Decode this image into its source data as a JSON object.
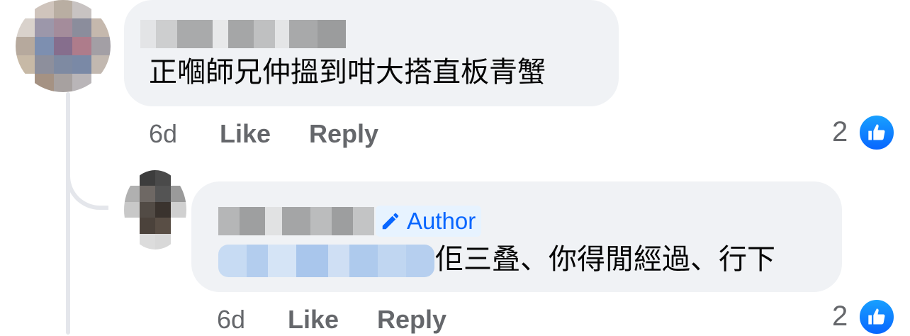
{
  "comments": [
    {
      "text": "正嗰師兄仲搵到咁大搭直板青蟹",
      "time": "6d",
      "like_label": "Like",
      "reply_label": "Reply",
      "reaction_count": "2",
      "reaction_icon": "thumbs-up-icon"
    },
    {
      "badge": "Author",
      "badge_icon": "pencil-icon",
      "text": "佢三叠、你得閒經過、行下",
      "time": "6d",
      "like_label": "Like",
      "reply_label": "Reply",
      "reaction_count": "2",
      "reaction_icon": "thumbs-up-icon"
    }
  ],
  "colors": {
    "bubble": "#f0f2f5",
    "meta_text": "#65676b",
    "accent": "#0866ff",
    "badge_bg": "#e7f3ff"
  }
}
